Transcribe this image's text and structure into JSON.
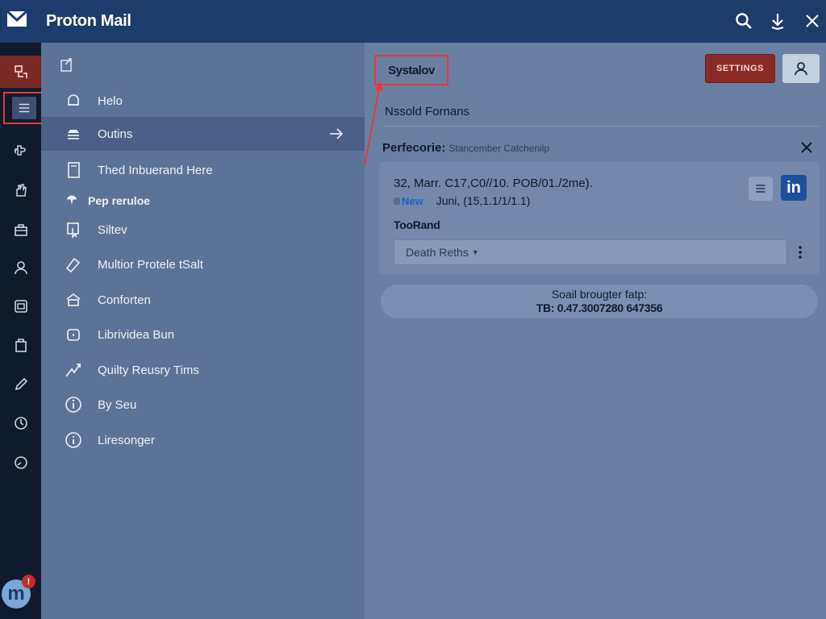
{
  "app": {
    "title": "Proton Mail"
  },
  "colors": {
    "topbar": "#1d3c6b",
    "rail": "#0f1b2c",
    "accent_red": "#e43a3a",
    "settings_bg": "#8a2a24",
    "linkedin": "#1d4f9c"
  },
  "rail": {
    "items": [
      "robot-icon",
      "list-icon",
      "puzzle-icon",
      "hand-icon",
      "briefcase-icon",
      "user-icon",
      "camera-icon",
      "bag-icon",
      "pencil-icon",
      "clock-icon",
      "dashboard-icon"
    ],
    "badge": "!",
    "avatar": "m"
  },
  "folders": {
    "items": [
      {
        "label": "Helo",
        "icon": "bell-icon"
      },
      {
        "label": "Outins",
        "icon": "tray-icon"
      },
      {
        "label": "Thed Inbuerand Here",
        "icon": "document-icon"
      },
      {
        "label": "Pep reruloe",
        "icon": "drop-icon"
      },
      {
        "label": "Siltev",
        "icon": "cursor-icon"
      },
      {
        "label": "Multior Protele tSalt",
        "icon": "tag-icon"
      },
      {
        "label": "Conforten",
        "icon": "home-icon"
      },
      {
        "label": "Librividea Bun",
        "icon": "lock-icon"
      },
      {
        "label": "Quilty Reusry Tims",
        "icon": "zigzag-icon"
      },
      {
        "label": "By Seu",
        "icon": "info-icon"
      },
      {
        "label": "Liresonger",
        "icon": "info-circle-icon"
      }
    ]
  },
  "content": {
    "title": "Systalov",
    "settings_label": "SETTINGS",
    "section_title": "Nssold Fornans",
    "card_head": "Perfecorie:",
    "card_sub": "Stancember Catchenilp",
    "line1": "32, Marr.  C17,C0//10. POB/01./2me).",
    "new_label": "New",
    "line2": "Juni,  (15,1.1/1/1.1)",
    "card_label": "TooRand",
    "select_value": "Death Reths",
    "footer_line1": "Soail brougter fatp:",
    "footer_line2": "TB: 0.47.3007280 647356",
    "linkedin_label": "in"
  }
}
